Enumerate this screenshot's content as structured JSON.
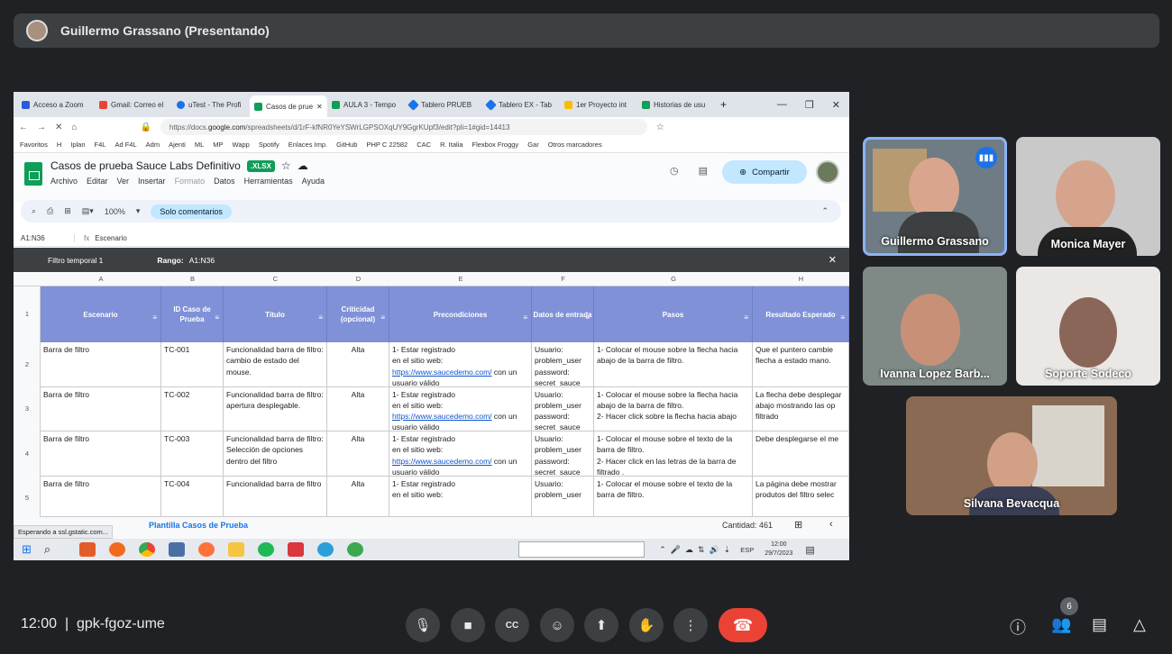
{
  "presenter": {
    "name": "Guillermo Grassano (Presentando)"
  },
  "browser": {
    "tabs": [
      "Acceso a Zoom",
      "Gmail: Correo el",
      "uTest - The Profi",
      "Casos de prue",
      "AULA 3 - Tempo",
      "Tablero PRUEB",
      "Tablero EX - Tab",
      "1er Proyecto int",
      "Historias de usu"
    ],
    "url_prefix": "https://docs.",
    "url_domain": "google.com",
    "url_rest": "/spreadsheets/d/1rF-kfNR0YeYSWrLGPSOXqUY9GgrKUpf3/edit?pli=1#gid=14413",
    "bookmarks": [
      "Favoritos",
      "H",
      "Iplan",
      "F4L",
      "Ad F4L",
      "Adm",
      "Ajenti",
      "ML",
      "MP",
      "Wapp",
      "Spotify",
      "Enlaces Imp.",
      "GitHub",
      "PHP C 22582",
      "CAC",
      "R. Italia",
      "Flexbox Froggy",
      "Gar",
      "Otros marcadores"
    ]
  },
  "sheet": {
    "title": "Casos de prueba Sauce Labs Definitivo",
    "badge": ".XLSX",
    "menus": [
      "Archivo",
      "Editar",
      "Ver",
      "Insertar",
      "Formato",
      "Datos",
      "Herramientas",
      "Ayuda"
    ],
    "share_label": "Compartir",
    "zoom": "100%",
    "mode": "Solo comentarios",
    "cell_ref": "A1:N36",
    "formula": "Escenario",
    "filter_name": "Filtro temporal 1",
    "range_label": "Rango:",
    "range": "A1:N36",
    "columns": [
      "A",
      "B",
      "C",
      "D",
      "E",
      "F",
      "G",
      "H"
    ],
    "rows": [
      "1",
      "2",
      "3",
      "4",
      "5"
    ],
    "headers": [
      "Escenario",
      "ID Caso de Prueba",
      "Título",
      "Criticidad (opcional)",
      "Precondiciones",
      "Datos de entrada",
      "Pasos",
      "Resultado Esperado"
    ],
    "data": [
      [
        "Barra de filtro",
        "TC-001",
        "Funcionalidad barra de filtro: cambio de estado del mouse.",
        "Alta",
        "1- Estar registrado\nen el sitio web:\nhttps://www.saucedemo.com/ con un usuario válido",
        "Usuario: problem_user password: secret_sauce",
        "1- Colocar el mouse sobre la flecha hacia abajo de la barra de filtro.",
        "Que el puntero cambie flecha a estado mano."
      ],
      [
        "Barra de filtro",
        "TC-002",
        "Funcionalidad barra de filtro: apertura desplegable.",
        "Alta",
        "1- Estar registrado\nen el sitio web:\nhttps://www.saucedemo.com/ con un usuario válido",
        "Usuario: problem_user password: secret_sauce",
        "1- Colocar el mouse sobre la flecha hacia abajo de la barra de filtro.\n2- Hacer click sobre la flecha hacia abajo",
        "La flecha debe desplegar abajo mostrando las op filtrado"
      ],
      [
        "Barra de filtro",
        "TC-003",
        "Funcionalidad barra de filtro: Selección de opciones dentro del filtro",
        "Alta",
        "1- Estar registrado\nen el sitio web:\nhttps://www.saucedemo.com/ con un usuario válido",
        "Usuario: problem_user password: secret_sauce",
        "1- Colocar el mouse sobre el texto de la barra de filtro.\n2- Hacer click en las letras de la barra de filtrado .",
        "Debe desplegarse el me"
      ],
      [
        "Barra de filtro",
        "TC-004",
        "Funcionalidad barra de filtro",
        "Alta",
        "1- Estar registrado\nen el sitio web:",
        "Usuario: problem_user",
        "1- Colocar el mouse sobre el texto de la barra de filtro.",
        "La página debe mostrar produtos del filtro selec"
      ]
    ],
    "sheet_tab": "Plantilla Casos de Prueba",
    "count_label": "Cantidad: 461",
    "status": "Esperando a ssl.gstatic.com..."
  },
  "taskbar": {
    "time": "12:00",
    "date": "29/7/2023",
    "lang": "ESP"
  },
  "participants": [
    "Guillermo Grassano",
    "Monica Mayer",
    "Ivanna Lopez Barb...",
    "Soporte Sodeco",
    "Silvana Bevacqua"
  ],
  "meeting": {
    "time": "12:00",
    "code": "gpk-fgoz-ume",
    "people_count": "6"
  },
  "colors": {
    "accent": "#1a73e8",
    "end_call": "#ea4335",
    "header_fill": "#8091d8"
  }
}
